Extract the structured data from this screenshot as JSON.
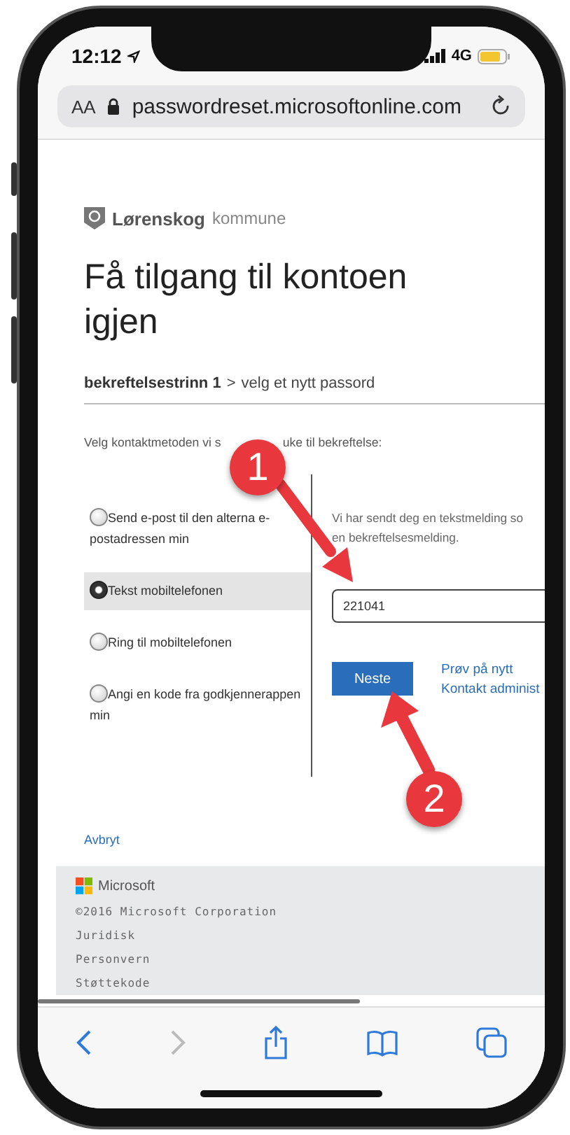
{
  "status_bar": {
    "time": "12:12",
    "network": "4G"
  },
  "address_bar": {
    "text_size": "AA",
    "url": "passwordreset.microsoftonline.com"
  },
  "page": {
    "org": {
      "name": "Lørenskog",
      "suffix": "kommune"
    },
    "title": "Få tilgang til kontoen igjen",
    "breadcrumb": {
      "current": "bekreftelsestrinn 1",
      "separator": ">",
      "next": "velg et nytt passord"
    },
    "instruction": [
      "Velg kontaktmetoden vi s",
      "uke til bekreftelse:"
    ],
    "options": [
      {
        "label": "Send e-post til den alterna e-postadressen min",
        "selected": false
      },
      {
        "label": "Tekst mobiltelefonen",
        "selected": true
      },
      {
        "label": "Ring til mobiltelefonen",
        "selected": false
      },
      {
        "label": "Angi en kode fra godkjennerappen min",
        "selected": false
      }
    ],
    "message": [
      "Vi har sendt deg en tekstmelding so",
      "en bekreftelsesmelding."
    ],
    "code_field": {
      "value": "221041"
    },
    "next_button": "Neste",
    "links": [
      "Prøv på nytt",
      "Kontakt administ"
    ],
    "cancel": "Avbryt",
    "footer": {
      "brand": "Microsoft",
      "copyright": "©2016 Microsoft Corporation",
      "links": [
        "Juridisk",
        "Personvern",
        "Støttekode"
      ]
    }
  },
  "annotations": [
    {
      "label": "1"
    },
    {
      "label": "2"
    }
  ],
  "toolbar": {
    "forward_disabled": true
  }
}
